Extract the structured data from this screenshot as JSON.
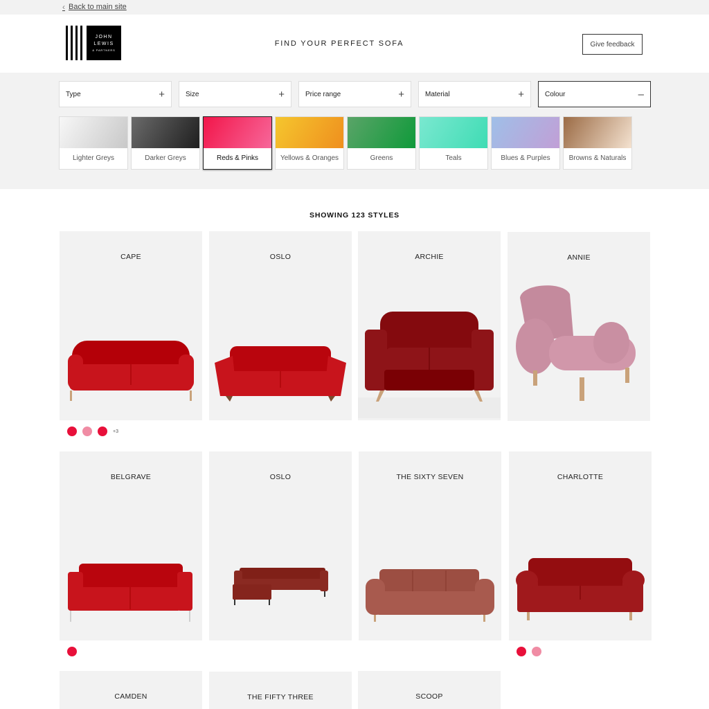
{
  "topbar": {
    "back_label": "Back to main site"
  },
  "header": {
    "logo": {
      "line1": "JOHN",
      "line2": "LEWIS",
      "line3": "& PARTNERS"
    },
    "title": "FIND YOUR PERFECT SOFA",
    "feedback_label": "Give feedback"
  },
  "filters": {
    "dropdowns": [
      {
        "label": "Type",
        "sign": "+"
      },
      {
        "label": "Size",
        "sign": "+"
      },
      {
        "label": "Price range",
        "sign": "+"
      },
      {
        "label": "Material",
        "sign": "+"
      },
      {
        "label": "Colour",
        "sign": "–"
      }
    ],
    "colours": [
      {
        "label": "Lighter Greys",
        "from": "#f7f7f7",
        "to": "#c8c8c8"
      },
      {
        "label": "Darker Greys",
        "from": "#6a6a6a",
        "to": "#1f1f1f"
      },
      {
        "label": "Reds & Pinks",
        "from": "#f2164a",
        "to": "#f7679a",
        "selected": true
      },
      {
        "label": "Yellows & Oranges",
        "from": "#f5c62e",
        "to": "#ef8f1e"
      },
      {
        "label": "Greens",
        "from": "#5aa468",
        "to": "#0f9a3a"
      },
      {
        "label": "Teals",
        "from": "#7ae8d0",
        "to": "#3fdcb4"
      },
      {
        "label": "Blues & Purples",
        "from": "#9fbfe8",
        "to": "#c19fd6"
      },
      {
        "label": "Browns & Naturals",
        "from": "#9b6b45",
        "to": "#f4e2d0"
      }
    ]
  },
  "results": {
    "count_label": "SHOWING 123 STYLES",
    "products": [
      {
        "name": "CAPE",
        "sofa_color": "#c8141c",
        "swatches": [
          "#e8103a",
          "#f08ca4",
          "#e8103a"
        ],
        "more": "+3"
      },
      {
        "name": "OSLO",
        "sofa_color": "#c8141c",
        "swatches": []
      },
      {
        "name": "ARCHIE",
        "sofa_color": "#8e1418",
        "swatches": []
      },
      {
        "name": "ANNIE",
        "sofa_color": "#c98fa2",
        "swatches": []
      },
      {
        "name": "BELGRAVE",
        "sofa_color": "#c8141c",
        "swatches": [
          "#e8103a"
        ]
      },
      {
        "name": "OSLO",
        "sofa_color": "#8a2a22",
        "swatches": []
      },
      {
        "name": "THE SIXTY SEVEN",
        "sofa_color": "#a85a4e",
        "swatches": []
      },
      {
        "name": "CHARLOTTE",
        "sofa_color": "#a0191c",
        "swatches": [
          "#e8103a",
          "#f08ca4"
        ]
      },
      {
        "name": "CAMDEN"
      },
      {
        "name": "THE FIFTY THREE"
      },
      {
        "name": "SCOOP"
      }
    ]
  }
}
